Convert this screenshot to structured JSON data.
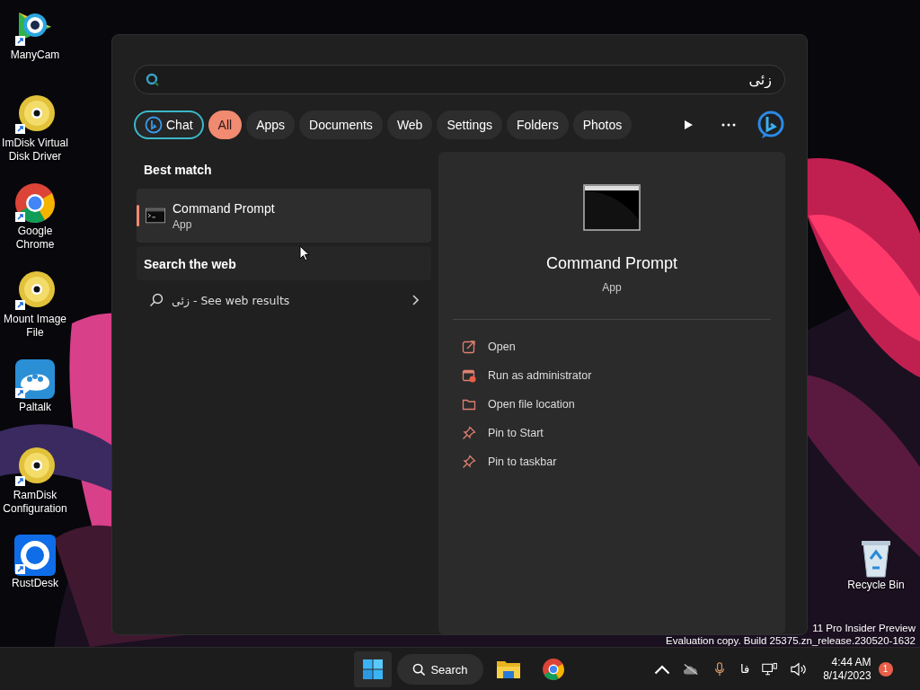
{
  "desktop_icons": [
    {
      "label": "ManyCam",
      "kind": "camera"
    },
    {
      "label": "ImDisk Virtual Disk Driver",
      "kind": "disc"
    },
    {
      "label": "Google Chrome",
      "kind": "chrome"
    },
    {
      "label": "Mount Image File",
      "kind": "disc"
    },
    {
      "label": "Paltalk",
      "kind": "people"
    },
    {
      "label": "RamDisk Configuration",
      "kind": "disc"
    },
    {
      "label": "RustDesk",
      "kind": "ring"
    }
  ],
  "recycle_bin": {
    "label": "Recycle Bin"
  },
  "watermark": [
    "11 Pro Insider Preview",
    "Evaluation copy. Build 25375.zn_release.230520-1632"
  ],
  "search": {
    "value": "زئی"
  },
  "filters": [
    {
      "label": "Chat",
      "kind": "chat",
      "selected": false
    },
    {
      "label": "All",
      "kind": "chip",
      "selected": true
    },
    {
      "label": "Apps",
      "kind": "chip",
      "selected": false
    },
    {
      "label": "Documents",
      "kind": "chip",
      "selected": false
    },
    {
      "label": "Web",
      "kind": "chip",
      "selected": false
    },
    {
      "label": "Settings",
      "kind": "chip",
      "selected": false
    },
    {
      "label": "Folders",
      "kind": "chip",
      "selected": false
    },
    {
      "label": "Photos",
      "kind": "chip",
      "selected": false
    }
  ],
  "best_match": {
    "heading": "Best match",
    "title": "Command Prompt",
    "subtitle": "App",
    "selected": true
  },
  "web": {
    "heading": "Search the web",
    "query": "زئی - See web results"
  },
  "detail": {
    "title": "Command Prompt",
    "subtitle": "App",
    "actions": [
      {
        "label": "Open",
        "kind": "open"
      },
      {
        "label": "Run as administrator",
        "kind": "admin"
      },
      {
        "label": "Open file location",
        "kind": "folder"
      },
      {
        "label": "Pin to Start",
        "kind": "pin"
      },
      {
        "label": "Pin to taskbar",
        "kind": "pin"
      }
    ]
  },
  "taskbar": {
    "search": "Search",
    "language": "فا",
    "time": "4:44 AM",
    "date": "8/14/2023",
    "badge": "1"
  }
}
